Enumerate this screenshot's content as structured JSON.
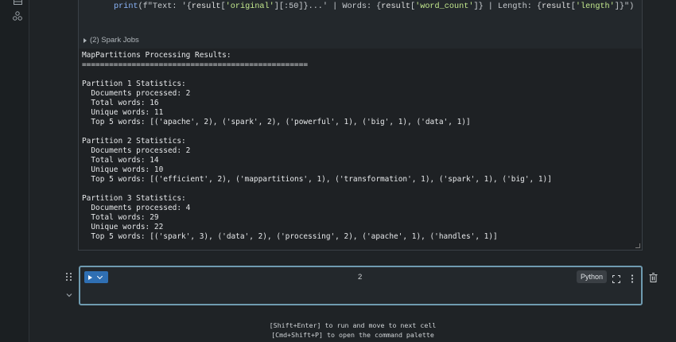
{
  "code_cell": {
    "code_parts": {
      "fn": "print",
      "p1": "(f\"Text: '{",
      "v1": "result",
      "p2": "[",
      "k1": "'original'",
      "p3": "][:50]}...' | Words: {",
      "v2": "result",
      "p4": "[",
      "k2": "'word_count'",
      "p5": "]} | Length: {",
      "v3": "result",
      "p6": "[",
      "k3": "'length'",
      "p7": "]}\")"
    },
    "spark_jobs_label": "(2) Spark Jobs"
  },
  "output": {
    "text": "MapPartitions Processing Results:\n==================================================\n\nPartition 1 Statistics:\n  Documents processed: 2\n  Total words: 16\n  Unique words: 11\n  Top 5 words: [('apache', 2), ('spark', 2), ('powerful', 1), ('big', 1), ('data', 1)]\n\nPartition 2 Statistics:\n  Documents processed: 2\n  Total words: 14\n  Unique words: 10\n  Top 5 words: [('efficient', 2), ('mappartitions', 1), ('transformation', 1), ('spark', 1), ('big', 1)]\n\nPartition 3 Statistics:\n  Documents processed: 4\n  Total words: 29\n  Unique words: 22\n  Top 5 words: [('spark', 3), ('data', 2), ('processing', 2), ('apache', 1), ('handles', 1)]"
  },
  "new_cell": {
    "number": "2",
    "language": "Python"
  },
  "hints": {
    "line1": "[Shift+Enter] to run and move to next cell",
    "line2": "[Cmd+Shift+P] to open the command palette"
  },
  "colors": {
    "accent": "#2f6fb3",
    "focus_border": "#6f9bb0"
  }
}
